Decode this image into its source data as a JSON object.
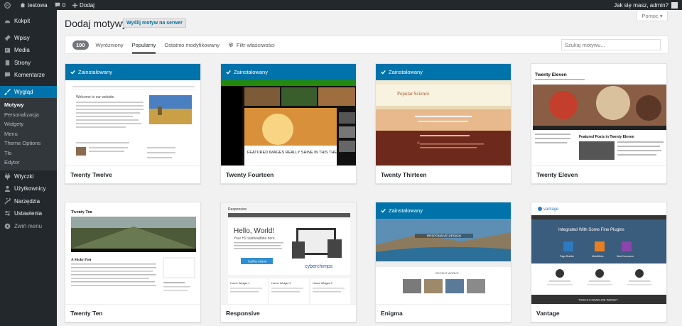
{
  "adminbar": {
    "site_name": "testowa",
    "comments_count": "0",
    "add_new": "Dodaj",
    "greeting": "Jak się masz, admin?"
  },
  "sidebar": {
    "items": [
      {
        "label": "Kokpit",
        "icon": "dashboard-icon"
      },
      {
        "label": "Wpisy",
        "icon": "pin-icon"
      },
      {
        "label": "Media",
        "icon": "media-icon"
      },
      {
        "label": "Strony",
        "icon": "page-icon"
      },
      {
        "label": "Komentarze",
        "icon": "comment-icon"
      },
      {
        "label": "Wygląd",
        "icon": "brush-icon"
      },
      {
        "label": "Wtyczki",
        "icon": "plugin-icon"
      },
      {
        "label": "Użytkownicy",
        "icon": "users-icon"
      },
      {
        "label": "Narzędzia",
        "icon": "wrench-icon"
      },
      {
        "label": "Ustawienia",
        "icon": "settings-icon"
      },
      {
        "label": "Zwiń menu",
        "icon": "collapse-icon"
      }
    ],
    "submenu": [
      "Motywy",
      "Personalizacja",
      "Widgety",
      "Menu",
      "Theme Options",
      "Tło",
      "Edytor"
    ]
  },
  "header": {
    "help": "Pomoc",
    "title": "Dodaj motywy",
    "upload": "Wyślij motyw na serwer"
  },
  "filter": {
    "count": "100",
    "tabs": [
      "Wyróżniony",
      "Popularny",
      "Ostatnio modyfikowany"
    ],
    "feature_filter": "Filtr właściwości",
    "search_placeholder": "Szukaj motywu..."
  },
  "installed_label": "Zainstalowany",
  "themes": [
    {
      "name": "Twenty Twelve",
      "installed": true
    },
    {
      "name": "Twenty Fourteen",
      "installed": true
    },
    {
      "name": "Twenty Thirteen",
      "installed": true
    },
    {
      "name": "Twenty Eleven",
      "installed": false
    },
    {
      "name": "Twenty Ten",
      "installed": false
    },
    {
      "name": "Responsive",
      "installed": false
    },
    {
      "name": "Enigma",
      "installed": true
    },
    {
      "name": "Vantage",
      "installed": false
    }
  ],
  "shots": {
    "twelve": {
      "heading": "Welcome to our website"
    },
    "fourteen": {
      "headline": "FEATURED IMAGES REALLY SHINE IN THIS THEME"
    },
    "thirteen": {
      "title": "Popular Science"
    },
    "eleven": {
      "title": "Twenty Eleven",
      "featured": "Featured Posts in Twenty Eleven"
    },
    "ten": {
      "title": "Twenty Ten",
      "post": "A Sticky Post"
    },
    "responsive": {
      "brand": "Responsive",
      "hello": "Hello, World!",
      "sub": "Your H2 subheadline here",
      "cta": "Call to Action",
      "logo": "cyberchimps",
      "w1": "Home Widget 1",
      "w2": "Home Widget 2",
      "w3": "Home Widget 3"
    },
    "enigma": {
      "banner": "RESPONSIVE DESIGN",
      "recent": "RECENT WORKS"
    },
    "vantage": {
      "brand": "vantage",
      "hero": "Integrated With Some Fine Plugins",
      "p1": "Page Builder",
      "p2": "MetaSlider",
      "p3": "WooCommerce",
      "footer": "THIS IS A HEADLINE WIDGET"
    }
  },
  "colors": {
    "accent": "#0073aa",
    "sidebar": "#23282d"
  }
}
